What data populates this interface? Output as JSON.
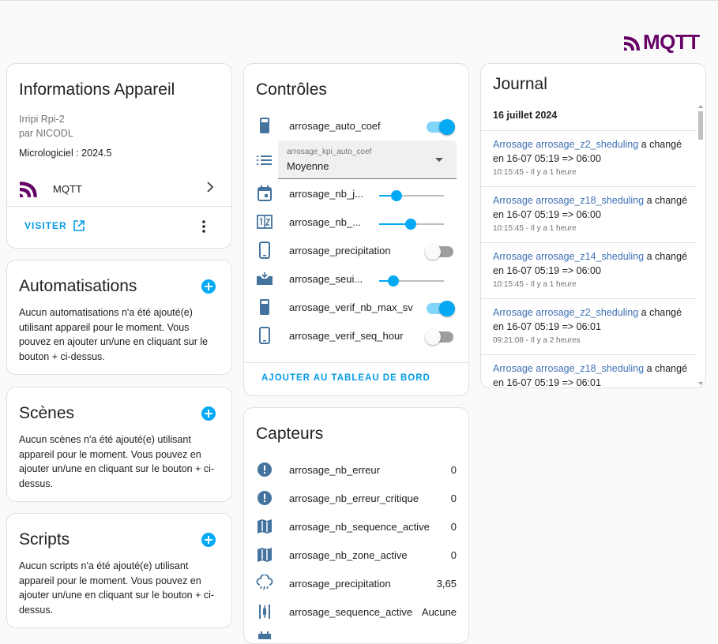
{
  "brand": {
    "logo_text": "MQTT",
    "color": "#660066"
  },
  "info_card": {
    "title": "Informations Appareil",
    "model": "Irripi Rpi-2",
    "manufacturer": "par NICODL",
    "firmware": "Micrologiciel : 2024.5",
    "integration_label": "MQTT",
    "visit_label": "VISITER"
  },
  "automations": {
    "title": "Automatisations",
    "description": "Aucun automatisations n'a été ajouté(e) utilisant appareil pour le moment. Vous pouvez en ajouter un/une en cliquant sur le bouton + ci-dessus."
  },
  "scenes": {
    "title": "Scènes",
    "description": "Aucun scènes n'a été ajouté(e) utilisant appareil pour le moment. Vous pouvez en ajouter un/une en cliquant sur le bouton + ci-dessus."
  },
  "scripts": {
    "title": "Scripts",
    "description": "Aucun scripts n'a été ajouté(e) utilisant appareil pour le moment. Vous pouvez en ajouter un/une en cliquant sur le bouton + ci-dessus."
  },
  "controls": {
    "title": "Contrôles",
    "items": [
      {
        "name": "arrosage_auto_coef",
        "type": "toggle",
        "state": "on",
        "icon": "cellphone-icon"
      },
      {
        "name": "arrosage_kpi_auto_coef",
        "type": "select",
        "value": "Moyenne",
        "icon": "format-list-icon"
      },
      {
        "name": "arrosage_nb_j...",
        "type": "slider",
        "level": 0.27,
        "icon": "calendar-icon"
      },
      {
        "name": "arrosage_nb_...",
        "type": "slider",
        "level": 0.49,
        "icon": "counter-icon"
      },
      {
        "name": "arrosage_precipitation",
        "type": "toggle",
        "state": "off",
        "icon": "cellphone-icon"
      },
      {
        "name": "arrosage_seui...",
        "type": "slider",
        "level": 0.22,
        "icon": "tray-icon"
      },
      {
        "name": "arrosage_verif_nb_max_sv",
        "type": "toggle",
        "state": "on",
        "icon": "cellphone-icon"
      },
      {
        "name": "arrosage_verif_seq_hour",
        "type": "toggle",
        "state": "off",
        "icon": "cellphone-icon"
      }
    ],
    "add_dashboard_label": "AJOUTER AU TABLEAU DE BORD"
  },
  "sensors": {
    "title": "Capteurs",
    "items": [
      {
        "name": "arrosage_nb_erreur",
        "value": "0",
        "icon": "alert-circle-icon"
      },
      {
        "name": "arrosage_nb_erreur_critique",
        "value": "0",
        "icon": "alert-circle-icon"
      },
      {
        "name": "arrosage_nb_sequence_active",
        "value": "0",
        "icon": "map-icon"
      },
      {
        "name": "arrosage_nb_zone_active",
        "value": "0",
        "icon": "map-icon"
      },
      {
        "name": "arrosage_precipitation",
        "value": "3,65",
        "icon": "weather-rainy-icon"
      },
      {
        "name": "arrosage_sequence_active",
        "value": "Aucune",
        "icon": "tune-vertical-icon"
      }
    ]
  },
  "journal": {
    "title": "Journal",
    "date": "16 juillet 2024",
    "entries": [
      {
        "entity": "Arrosage arrosage_z2_sheduling",
        "action": "a changé",
        "change": "en 16-07 05:19 => 06:00",
        "time": "10:15:45 - Il y a 1 heure"
      },
      {
        "entity": "Arrosage arrosage_z18_sheduling",
        "action": "a changé",
        "change": "en 16-07 05:19 => 06:00",
        "time": "10:15:45 - Il y a 1 heure"
      },
      {
        "entity": "Arrosage arrosage_z14_sheduling",
        "action": "a changé",
        "change": "en 16-07 05:19 => 06:00",
        "time": "10:15:45 - Il y a 1 heure"
      },
      {
        "entity": "Arrosage arrosage_z2_sheduling",
        "action": "a changé",
        "change": "en 16-07 05:19 => 06:01",
        "time": "09:21:08 - Il y a 2 heures"
      },
      {
        "entity": "Arrosage arrosage_z18_sheduling",
        "action": "a changé",
        "change": "en 16-07 05:19 => 06:01",
        "time": ""
      }
    ]
  },
  "colors": {
    "accent": "#03a9f4",
    "link": "#3f6fb5",
    "brand": "#660066"
  }
}
